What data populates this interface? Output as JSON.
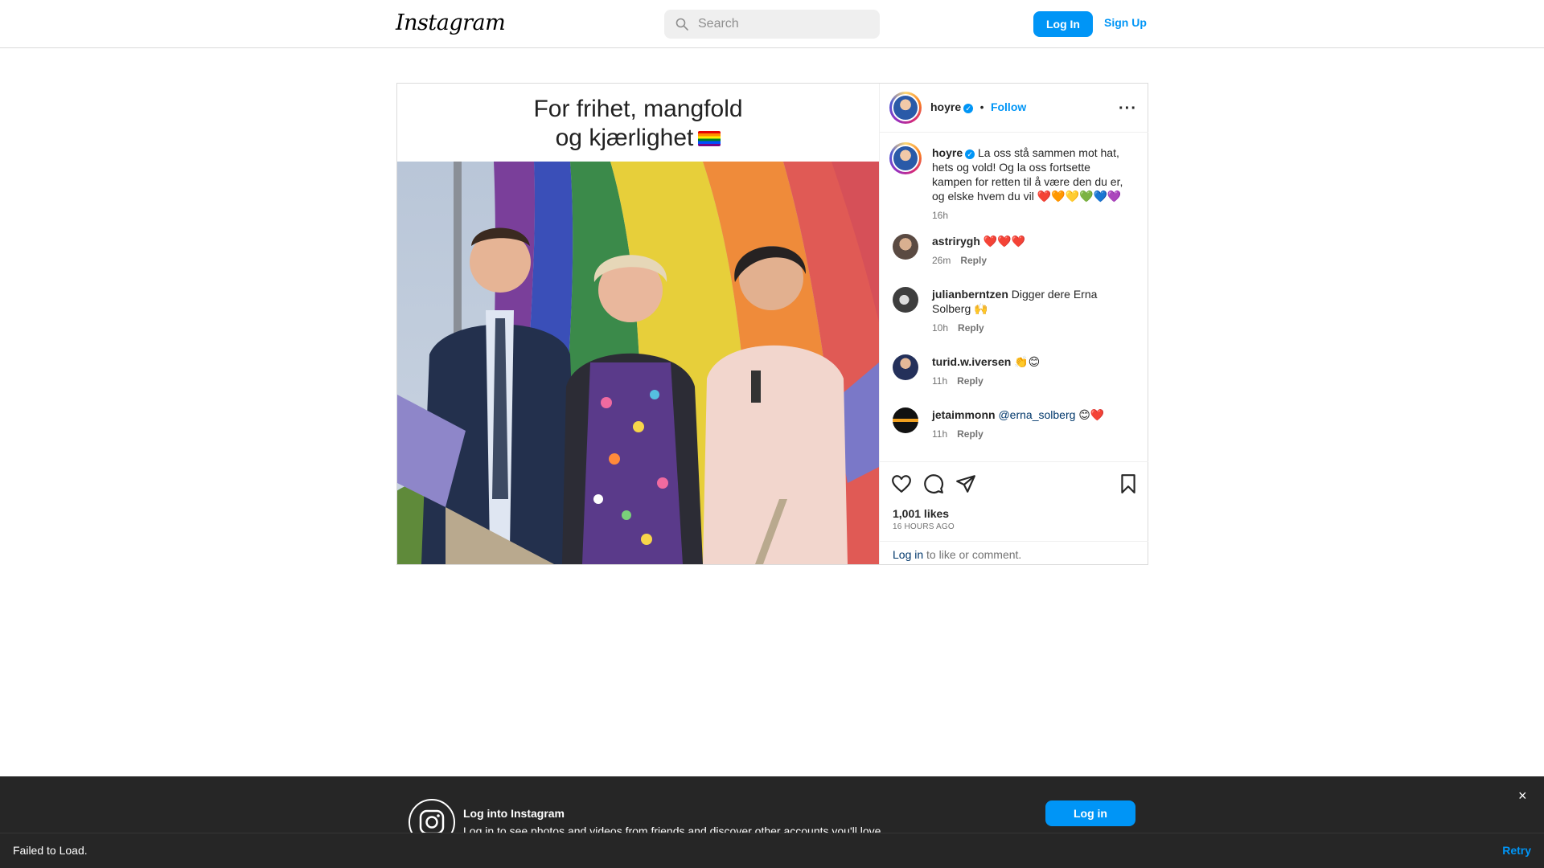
{
  "header": {
    "logo": "Instagram",
    "search_placeholder": "Search",
    "login_label": "Log In",
    "signup_label": "Sign Up"
  },
  "post": {
    "banner_line1": "For frihet, mangfold",
    "banner_line2": "og kjærlighet",
    "author": "hoyre",
    "verified": "✓",
    "separator": "•",
    "follow_label": "Follow",
    "more": "···",
    "caption": "La oss stå sammen mot hat, hets og vold! Og la oss fortsette kampen for retten til å være den du er, og elske hvem du vil ❤️🧡💛💚💙💜",
    "caption_time": "16h",
    "likes": "1,001 likes",
    "time_ago": "16 HOURS AGO",
    "login_link": "Log in",
    "login_suffix": " to like or comment."
  },
  "comments": [
    {
      "user": "astrirygh",
      "text": "❤️❤️❤️",
      "time": "26m",
      "reply": "Reply"
    },
    {
      "user": "julianberntzen",
      "text": "Digger dere Erna Solberg 🙌",
      "time": "10h",
      "reply": "Reply"
    },
    {
      "user": "turid.w.iversen",
      "text": "👏😊",
      "time": "11h",
      "reply": "Reply"
    },
    {
      "user": "jetaimmonn",
      "mention": "@erna_solberg",
      "text": "😊❤️",
      "time": "11h",
      "reply": "Reply"
    }
  ],
  "icons": [
    "search-icon",
    "heart-icon",
    "comment-icon",
    "share-icon",
    "bookmark-icon",
    "more-icon",
    "instagram-icon",
    "close-icon"
  ],
  "bottom_banner": {
    "title": "Log into Instagram",
    "subtitle": "Log in to see photos and videos from friends and discover other accounts you'll love.",
    "login_label": "Log in",
    "close": "×"
  },
  "toast": {
    "message": "Failed to Load.",
    "retry": "Retry"
  },
  "colors": {
    "accent": "#0095f6",
    "banner": "#262626",
    "link": "#00376b"
  }
}
